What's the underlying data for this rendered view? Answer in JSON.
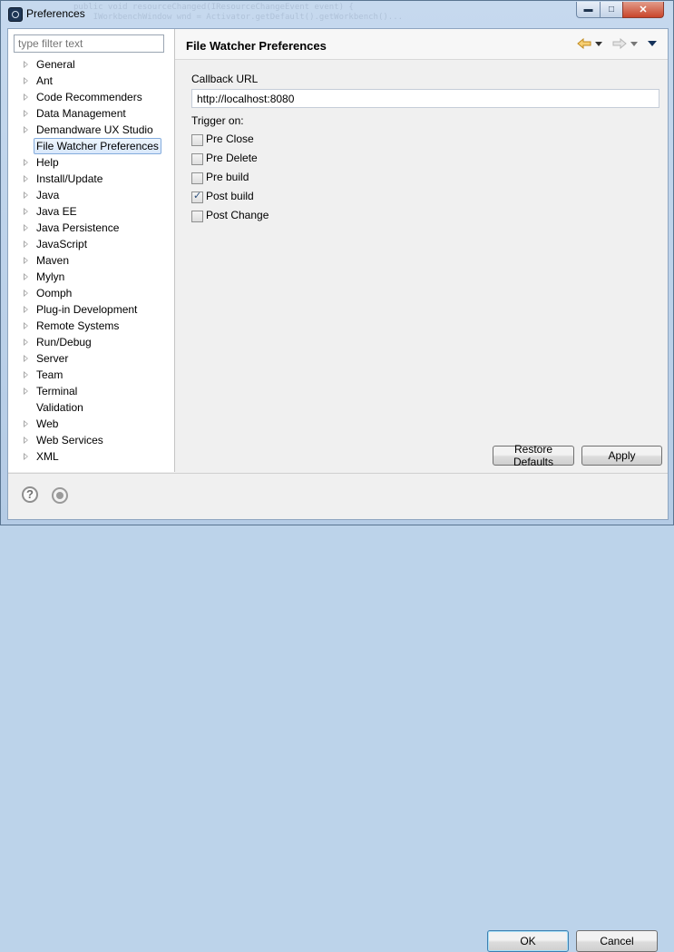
{
  "window": {
    "title": "Preferences",
    "background_code": "public void resourceChanged(IResourceChangeEvent event) {\n    IWorkbenchWindow wnd = Activator.getDefault().getWorkbench()..."
  },
  "filter": {
    "placeholder": "type filter text"
  },
  "tree": {
    "items": [
      {
        "label": "General",
        "expandable": true
      },
      {
        "label": "Ant",
        "expandable": true
      },
      {
        "label": "Code Recommenders",
        "expandable": true
      },
      {
        "label": "Data Management",
        "expandable": true
      },
      {
        "label": "Demandware UX Studio",
        "expandable": true
      },
      {
        "label": "File Watcher Preferences",
        "expandable": false,
        "selected": true
      },
      {
        "label": "Help",
        "expandable": true
      },
      {
        "label": "Install/Update",
        "expandable": true
      },
      {
        "label": "Java",
        "expandable": true
      },
      {
        "label": "Java EE",
        "expandable": true
      },
      {
        "label": "Java Persistence",
        "expandable": true
      },
      {
        "label": "JavaScript",
        "expandable": true
      },
      {
        "label": "Maven",
        "expandable": true
      },
      {
        "label": "Mylyn",
        "expandable": true
      },
      {
        "label": "Oomph",
        "expandable": true
      },
      {
        "label": "Plug-in Development",
        "expandable": true
      },
      {
        "label": "Remote Systems",
        "expandable": true
      },
      {
        "label": "Run/Debug",
        "expandable": true
      },
      {
        "label": "Server",
        "expandable": true
      },
      {
        "label": "Team",
        "expandable": true
      },
      {
        "label": "Terminal",
        "expandable": true
      },
      {
        "label": "Validation",
        "expandable": false
      },
      {
        "label": "Web",
        "expandable": true
      },
      {
        "label": "Web Services",
        "expandable": true
      },
      {
        "label": "XML",
        "expandable": true
      }
    ]
  },
  "page": {
    "title": "File Watcher Preferences",
    "callback_label": "Callback URL",
    "callback_value": "http://localhost:8080",
    "trigger_label": "Trigger on:",
    "triggers": [
      {
        "label": "Pre Close",
        "checked": false
      },
      {
        "label": "Pre Delete",
        "checked": false
      },
      {
        "label": "Pre build",
        "checked": false
      },
      {
        "label": "Post build",
        "checked": true
      },
      {
        "label": "Post Change",
        "checked": false
      }
    ]
  },
  "buttons": {
    "restore_defaults": "Restore Defaults",
    "apply": "Apply",
    "ok": "OK",
    "cancel": "Cancel"
  },
  "icons": {
    "help": "help-icon",
    "record": "record-icon",
    "back": "back-arrow-icon",
    "forward": "forward-arrow-icon",
    "view_menu": "view-menu-icon"
  },
  "colors": {
    "selection_border": "#84acdd",
    "ok_border": "#3c7fb1",
    "back_arrow": "#e8b04a",
    "forward_arrow": "#b5b5b5"
  }
}
